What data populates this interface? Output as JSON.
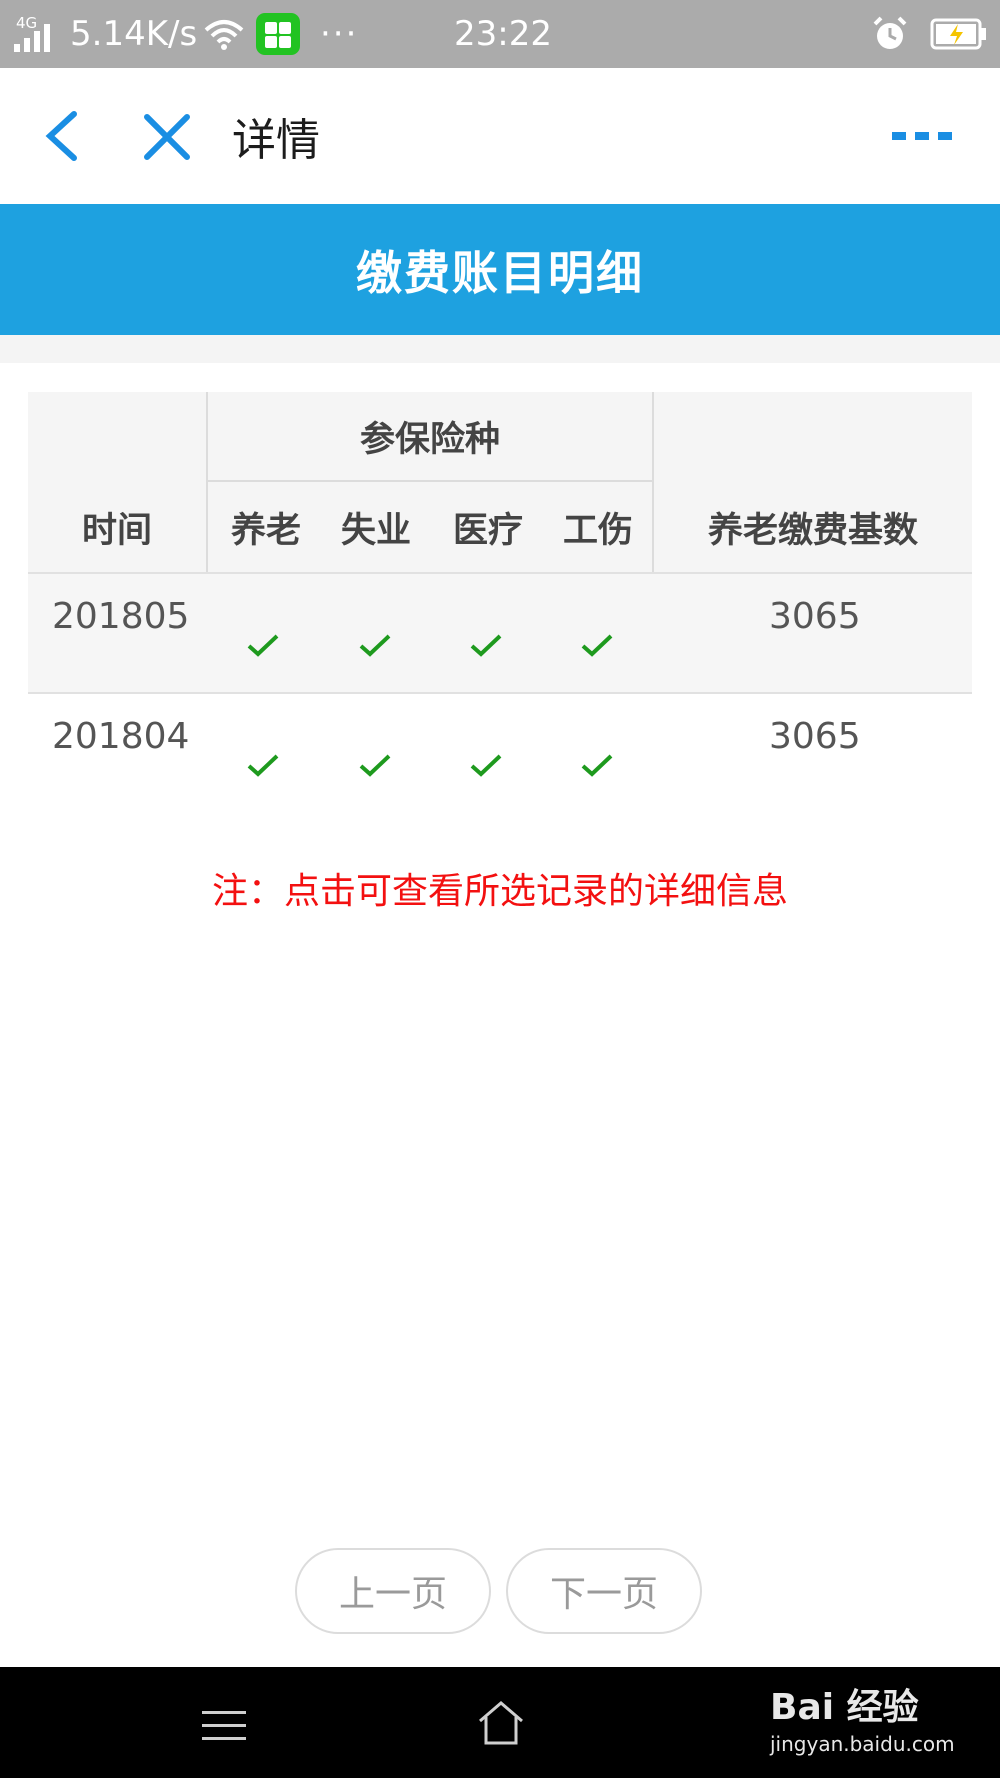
{
  "status_bar": {
    "network_type": "4G",
    "speed": "5.14K/s",
    "dots": "···",
    "time": "23:22"
  },
  "title_bar": {
    "title": "详情"
  },
  "banner": {
    "title": "缴费账目明细"
  },
  "table": {
    "header": {
      "time": "时间",
      "insurance_group": "参保险种",
      "types": [
        "养老",
        "失业",
        "医疗",
        "工伤"
      ],
      "base": "养老缴费基数"
    },
    "rows": [
      {
        "time": "201805",
        "checks": [
          true,
          true,
          true,
          true
        ],
        "base": "3065"
      },
      {
        "time": "201804",
        "checks": [
          true,
          true,
          true,
          true
        ],
        "base": "3065"
      }
    ]
  },
  "note": "注：点击可查看所选记录的详细信息",
  "pager": {
    "prev": "上一页",
    "next": "下一页"
  },
  "watermark": {
    "brand": "Bai 经验",
    "url": "jingyan.baidu.com"
  },
  "colors": {
    "accent": "#1ea1e0",
    "check": "#1e9a1e",
    "note": "#f31010"
  },
  "icons": [
    "back-arrow-icon",
    "close-icon",
    "more-icon",
    "menu-icon",
    "home-icon",
    "alarm-icon",
    "battery-icon",
    "wifi-icon",
    "signal-icon"
  ]
}
